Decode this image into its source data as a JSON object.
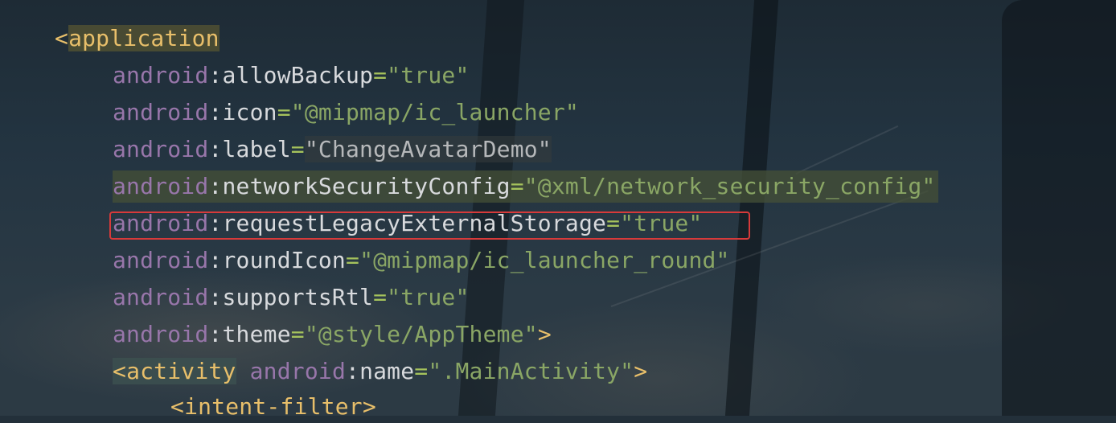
{
  "editor": {
    "lines": [
      {
        "tag_open": "<",
        "tag": "application"
      },
      {
        "ns": "android",
        "colon": ":",
        "attr": "allowBackup",
        "eq": "=",
        "value": "\"true\""
      },
      {
        "ns": "android",
        "colon": ":",
        "attr": "icon",
        "eq": "=",
        "value": "\"@mipmap/ic_launcher\""
      },
      {
        "ns": "android",
        "colon": ":",
        "attr": "label",
        "eq": "=",
        "value": "\"ChangeAvatarDemo\""
      },
      {
        "ns": "android",
        "colon": ":",
        "attr": "networkSecurityConfig",
        "eq": "=",
        "value": "\"@xml/network_security_config\""
      },
      {
        "ns": "android",
        "colon": ":",
        "attr": "requestLegacyExternalStorage",
        "eq": "=",
        "value": "\"true\""
      },
      {
        "ns": "android",
        "colon": ":",
        "attr": "roundIcon",
        "eq": "=",
        "value": "\"@mipmap/ic_launcher_round\""
      },
      {
        "ns": "android",
        "colon": ":",
        "attr": "supportsRtl",
        "eq": "=",
        "value": "\"true\""
      },
      {
        "ns": "android",
        "colon": ":",
        "attr": "theme",
        "eq": "=",
        "value": "\"@style/AppTheme\"",
        "close": ">"
      },
      {
        "tag_open": "<",
        "tag": "activity",
        "ns": "android",
        "colon": ":",
        "attr": "name",
        "eq": "=",
        "value": "\".MainActivity\"",
        "close": ">"
      },
      {
        "tag_open": "<",
        "tag": "intent-filter",
        "close": ">"
      }
    ]
  },
  "colors": {
    "tag": "#e8bf6a",
    "namespace": "#9876aa",
    "attribute": "#d8dadd",
    "value": "#8aa665",
    "highlight_box": "#d73a3a"
  }
}
